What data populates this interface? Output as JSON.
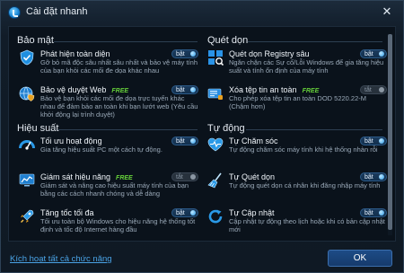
{
  "window": {
    "title": "Cài đặt nhanh"
  },
  "sections": {
    "security": {
      "title": "Bảo mật"
    },
    "cleanup": {
      "title": "Quét dọn"
    },
    "performance": {
      "title": "Hiệu suất"
    },
    "automation": {
      "title": "Tự động"
    }
  },
  "items": {
    "realtime_protection": {
      "name": "Phát hiện toàn diện",
      "desc": "Gỡ bỏ mã độc sâu nhất sâu nhất và bảo vệ máy tính của bạn khỏi các mối đe dọa khác nhau",
      "toggle": "bật",
      "icon": "shield-icon"
    },
    "browser_protection": {
      "name": "Bảo vệ duyệt Web",
      "free": "FREE",
      "desc": "Bảo vệ bạn khỏi các mối đe dọa trực tuyến khác nhau để đảm bảo an toàn khi bạn lướt web (Yêu cầu khởi động lại trình duyệt)",
      "toggle": "bật",
      "icon": "globe-shield-icon"
    },
    "registry_scan": {
      "name": "Quét dọn Registry sâu",
      "desc": "Ngăn chặn các Sự cố/Lỗi Windows để gia tăng hiệu suất và tính ổn định của máy tính",
      "toggle": "bật",
      "icon": "registry-grid-icon"
    },
    "secure_delete": {
      "name": "Xóa tệp tin an toàn",
      "free": "FREE",
      "desc": "Cho phép xóa tệp tin an toàn DOD 5220.22-M (Chậm hơn)",
      "toggle": "tắt",
      "icon": "secure-file-icon"
    },
    "performance_optimize": {
      "name": "Tối ưu hoạt động",
      "desc": "Gia tăng hiệu suất PC một cách tự động.",
      "toggle": "bật",
      "icon": "speedometer-icon"
    },
    "performance_monitor": {
      "name": "Giám sát hiệu năng",
      "free": "FREE",
      "desc": "Giám sát và nâng cao hiệu suất máy tính của bạn bằng các cách nhanh chóng và dễ dàng",
      "toggle": "tắt",
      "icon": "monitor-chart-icon"
    },
    "speed_boost": {
      "name": "Tăng tốc tối đa",
      "desc": "Tối ưu toàn bộ Windows cho hiệu năng hệ thống tốt định và tốc độ Internet hàng đầu",
      "toggle": "bật",
      "icon": "rocket-icon"
    },
    "auto_care": {
      "name": "Tự Chăm sóc",
      "desc": "Tự động chăm sóc máy tính khi hệ thống nhàn rỗi",
      "toggle": "bật",
      "icon": "heart-pulse-icon"
    },
    "auto_clean": {
      "name": "Tự Quét dọn",
      "desc": "Tự động quét dọn cá nhân khi đăng nhập máy tính",
      "toggle": "bật",
      "icon": "broom-icon"
    },
    "auto_update": {
      "name": "Tự Cập nhật",
      "desc": "Cập nhật tự động theo lịch hoặc khi có bản cập nhật mới",
      "toggle": "bật",
      "icon": "refresh-icon"
    }
  },
  "footer": {
    "activate_all_link": "Kích hoạt tất cả chức năng",
    "ok_label": "OK"
  },
  "colors": {
    "accent": "#2a9ae8",
    "free_badge": "#66d13a",
    "link": "#4aa3e6"
  }
}
